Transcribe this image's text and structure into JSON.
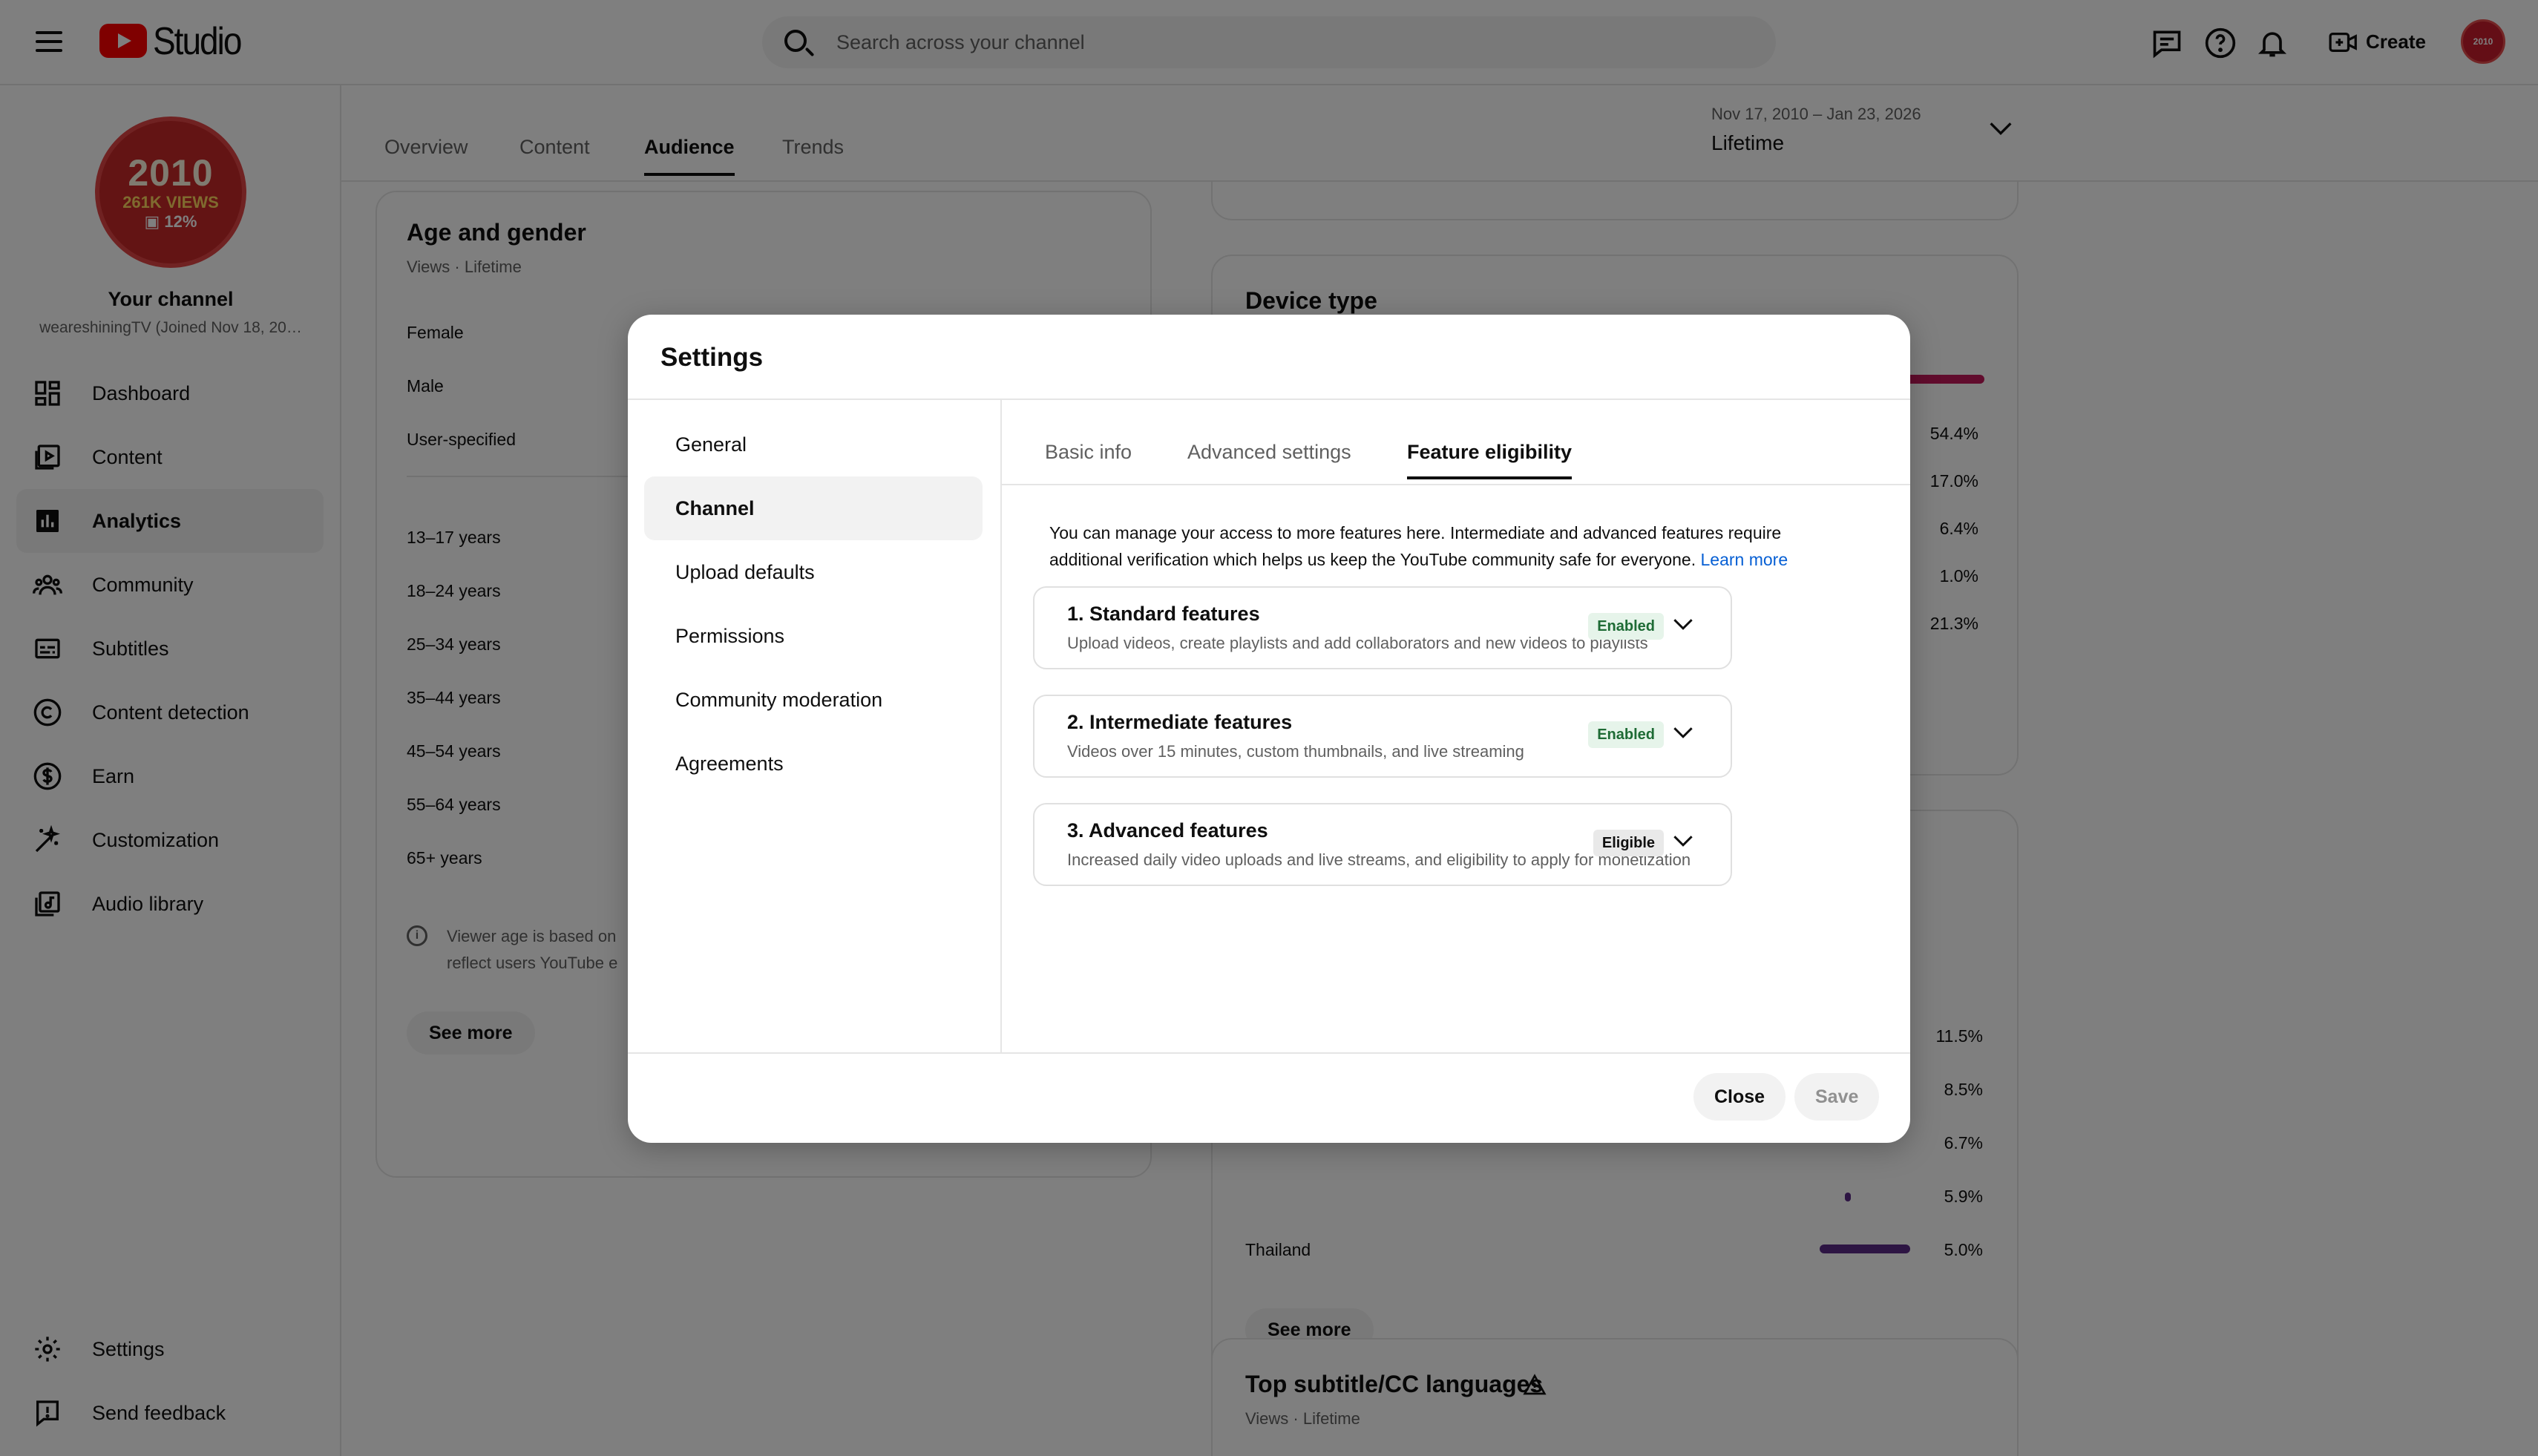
{
  "app": {
    "logo_text": "Studio",
    "search_placeholder": "Search across your channel",
    "create_label": "Create",
    "avatar_text": "2010"
  },
  "sidebar": {
    "avatar_lines": [
      "2010",
      "261K VIEWS",
      "▣ 12%"
    ],
    "channel_label": "Your channel",
    "channel_sub": "weareshiningTV (Joined Nov 18, 20…",
    "items": [
      {
        "label": "Dashboard",
        "icon": "dashboard-icon"
      },
      {
        "label": "Content",
        "icon": "content-icon"
      },
      {
        "label": "Analytics",
        "icon": "analytics-icon",
        "active": true
      },
      {
        "label": "Community",
        "icon": "community-icon"
      },
      {
        "label": "Subtitles",
        "icon": "subtitles-icon"
      },
      {
        "label": "Content detection",
        "icon": "copyright-icon"
      },
      {
        "label": "Earn",
        "icon": "dollar-icon"
      },
      {
        "label": "Customization",
        "icon": "magic-wand-icon"
      },
      {
        "label": "Audio library",
        "icon": "audio-library-icon"
      }
    ],
    "bottom_items": [
      {
        "label": "Settings",
        "icon": "gear-icon"
      },
      {
        "label": "Send feedback",
        "icon": "feedback-icon"
      }
    ]
  },
  "analytics": {
    "tabs": [
      "Overview",
      "Content",
      "Audience",
      "Trends"
    ],
    "active_tab": "Audience",
    "date_range": "Nov 17, 2010 – Jan 23, 2026",
    "date_label": "Lifetime",
    "age_gender": {
      "title": "Age and gender",
      "subtitle": "Views · Lifetime",
      "genders": [
        "Female",
        "Male",
        "User-specified"
      ],
      "ages": [
        "13–17 years",
        "18–24 years",
        "25–34 years",
        "35–44 years",
        "45–54 years",
        "55–64 years",
        "65+ years"
      ],
      "note_line1": "Viewer age is based on",
      "note_line2": "reflect users YouTube e",
      "see_more": "See more"
    },
    "device_type": {
      "title": "Device type",
      "percents": [
        "54.4%",
        "17.0%",
        "6.4%",
        "1.0%",
        "21.3%"
      ]
    },
    "geography": {
      "percents": [
        "11.5%",
        "8.5%",
        "6.7%",
        "5.9%",
        "5.0%"
      ],
      "last_country": "Thailand",
      "see_more": "See more"
    },
    "subtitles": {
      "title": "Top subtitle/CC languages",
      "subtitle": "Views · Lifetime"
    }
  },
  "dialog": {
    "title": "Settings",
    "nav": [
      "General",
      "Channel",
      "Upload defaults",
      "Permissions",
      "Community moderation",
      "Agreements"
    ],
    "active_nav": "Channel",
    "tabs": [
      "Basic info",
      "Advanced settings",
      "Feature eligibility"
    ],
    "active_tab": "Feature eligibility",
    "intro": "You can manage your access to more features here. Intermediate and advanced features require additional verification which helps us keep the YouTube community safe for everyone.",
    "learn_more": "Learn more",
    "features": [
      {
        "title": "1. Standard features",
        "desc": "Upload videos, create playlists and add collaborators and new videos to playlists",
        "status": "Enabled"
      },
      {
        "title": "2. Intermediate features",
        "desc": "Videos over 15 minutes, custom thumbnails, and live streaming",
        "status": "Enabled"
      },
      {
        "title": "3. Advanced features",
        "desc": "Increased daily video uploads and live streams, and eligibility to apply for monetization",
        "status": "Eligible"
      }
    ],
    "close_label": "Close",
    "save_label": "Save"
  },
  "colors": {
    "accent_pink": "#c2185b",
    "accent_purple": "#5b2a86",
    "link_blue": "#065fd4",
    "enabled_green": "#1e6b35"
  }
}
